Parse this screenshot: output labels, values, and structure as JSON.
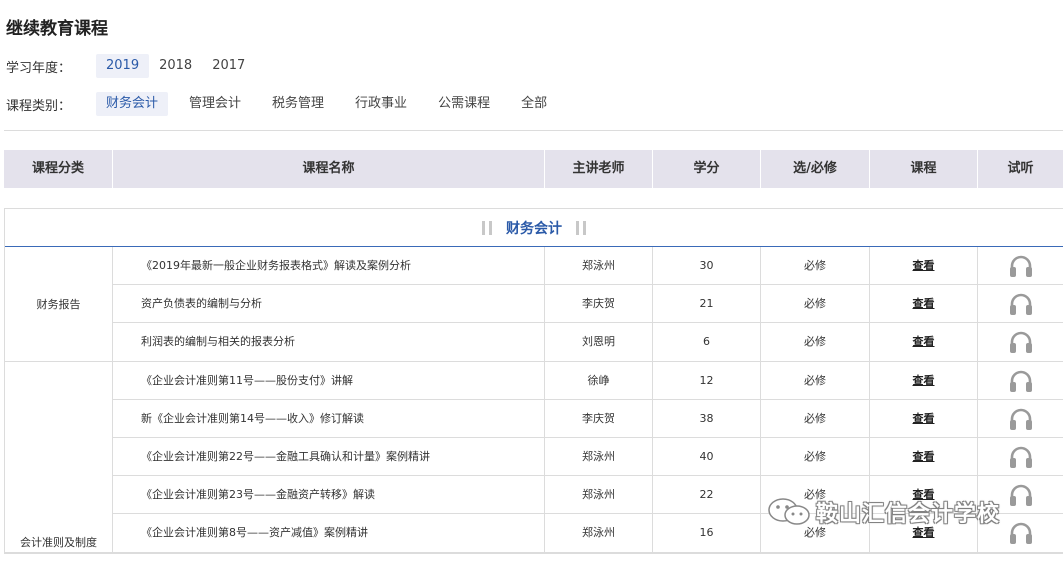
{
  "page": {
    "title": "继续教育课程"
  },
  "filters": {
    "year_label": "学习年度：",
    "years": [
      "2019",
      "2018",
      "2017"
    ],
    "year_selected": "2019",
    "category_label": "课程类别：",
    "categories": [
      "财务会计",
      "管理会计",
      "税务管理",
      "行政事业",
      "公需课程",
      "全部"
    ],
    "category_selected": "财务会计"
  },
  "table": {
    "headers": [
      "课程分类",
      "课程名称",
      "主讲老师",
      "学分",
      "选/必修",
      "课程",
      "试听"
    ],
    "section_title": "财务会计",
    "view_label": "查看",
    "groups": [
      {
        "name": "财务报告",
        "rows": [
          {
            "name": "《2019年最新一般企业财务报表格式》解读及案例分析",
            "teacher": "郑泳州",
            "credit": "30",
            "type": "必修"
          },
          {
            "name": "资产负债表的编制与分析",
            "teacher": "李庆贺",
            "credit": "21",
            "type": "必修"
          },
          {
            "name": "利润表的编制与相关的报表分析",
            "teacher": "刘恩明",
            "credit": "6",
            "type": "必修"
          }
        ]
      },
      {
        "name": "会计准则及制度",
        "rows": [
          {
            "name": "《企业会计准则第11号——股份支付》讲解",
            "teacher": "徐峥",
            "credit": "12",
            "type": "必修"
          },
          {
            "name": "新《企业会计准则第14号——收入》修订解读",
            "teacher": "李庆贺",
            "credit": "38",
            "type": "必修"
          },
          {
            "name": "《企业会计准则第22号——金融工具确认和计量》案例精讲",
            "teacher": "郑泳州",
            "credit": "40",
            "type": "必修"
          },
          {
            "name": "《企业会计准则第23号——金融资产转移》解读",
            "teacher": "郑泳州",
            "credit": "22",
            "type": "必修"
          },
          {
            "name": "《企业会计准则第8号——资产减值》案例精讲",
            "teacher": "郑泳州",
            "credit": "16",
            "type": "必修"
          }
        ]
      }
    ]
  },
  "watermark": {
    "text": "鞍山汇信会计学校",
    "icon": "wechat-icon"
  },
  "colors": {
    "accent": "#2b5aa8",
    "header_bg": "#e4e2ec",
    "active_bg": "#eef0f8"
  }
}
